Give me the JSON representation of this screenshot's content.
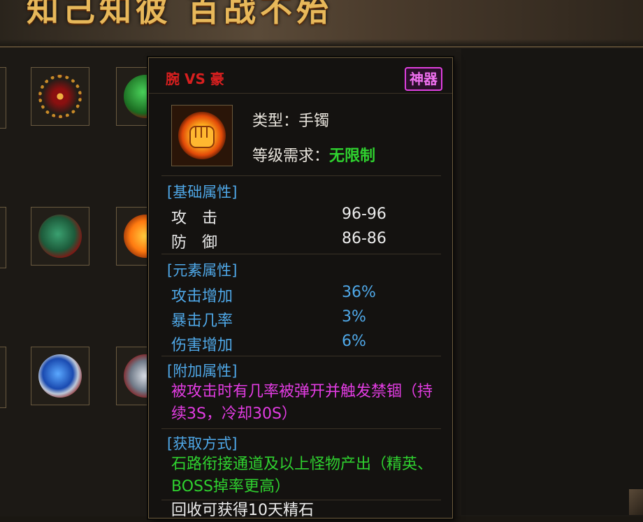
{
  "banner": {
    "title": "知己知彼  百战不殆"
  },
  "colors": {
    "item_name": "#d81f1f",
    "badge": "#e040e0",
    "section_title": "#4fa8e8",
    "element_stat": "#4fa8e8",
    "extra_attr": "#e23ce2",
    "acquire": "#2fd12f",
    "unrestricted": "#2fd12f"
  },
  "inventory": {
    "slots": [
      {
        "icon": "gold-chain-necklace-icon"
      },
      {
        "icon": "green-gem-necklace-icon"
      },
      {
        "icon": "jade-ring-icon"
      },
      {
        "icon": "fire-bracelet-icon"
      },
      {
        "icon": "blue-sapphire-ring-icon"
      },
      {
        "icon": "silver-ring-icon"
      }
    ]
  },
  "tooltip": {
    "name": "腕 VS 豪",
    "badge": "神器",
    "icon": "fire-fist-bracelet-icon",
    "type_label": "类型：手镯",
    "level_label": "等级需求：",
    "level_value": "无限制",
    "base_section": "[基础属性]",
    "base_stats": [
      {
        "label": "攻　击",
        "value": "96-96"
      },
      {
        "label": "防　御",
        "value": "86-86"
      }
    ],
    "element_section": "[元素属性]",
    "element_stats": [
      {
        "label": "攻击增加",
        "value": "36%"
      },
      {
        "label": "暴击几率",
        "value": "3%"
      },
      {
        "label": "伤害增加",
        "value": "6%"
      }
    ],
    "extra_section": "[附加属性]",
    "extra_text": "被攻击时有几率被弹开并触发禁锢（持续3S，冷却30S）",
    "acquire_section": "[获取方式]",
    "acquire_text": "石路衔接通道及以上怪物产出（精英、BOSS掉率更高）",
    "recycle_text": "回收可获得10天精石"
  }
}
